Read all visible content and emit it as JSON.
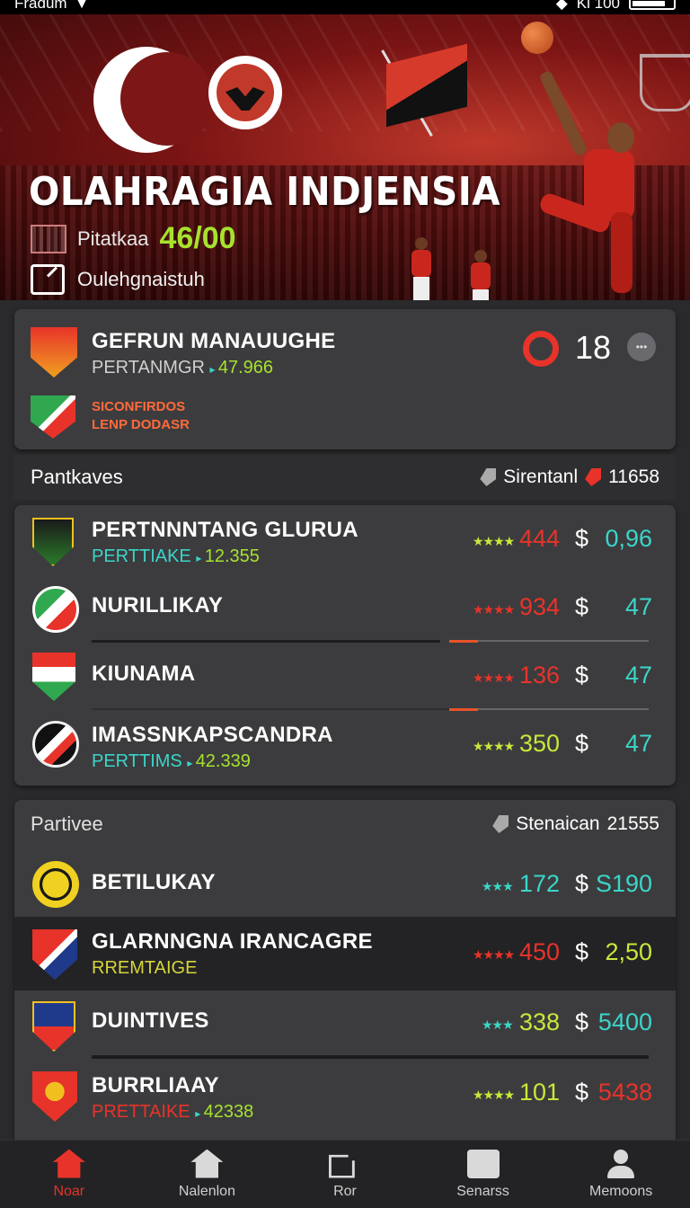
{
  "status_bar": {
    "carrier": "Fradum",
    "right_text": "Ki 100"
  },
  "hero": {
    "title": "OLAHRAGIA INDJENSIA",
    "stat_label": "Pitatkaa",
    "stat_value": "46/00",
    "action_label": "Oulehgnaistuh"
  },
  "featured_match": {
    "team": "GEFRUN MANAUUGHE",
    "sub_label": "PERTANMGR",
    "sub_value": "47.966",
    "line2": "SICONFIRDOS",
    "line3": "LENP DODASR",
    "score": "18"
  },
  "section1": {
    "name": "Pantkaves",
    "meta_label": "Sirentanl",
    "meta_value": "11658",
    "rows": [
      {
        "name": "PERTNNNTANG GLURUA",
        "sub_label": "PERTTIAKE",
        "sub_value": "12.355",
        "stars": "★★★★",
        "points": "444",
        "price": "0,96",
        "stars_color": "#c7e83a",
        "points_color": "#e8332a",
        "price_color": "#3ad6c9"
      },
      {
        "name": "NURILLIKAY",
        "sub_label": "",
        "sub_value": "",
        "stars": "★★★★",
        "points": "934",
        "price": "47",
        "stars_color": "#e8332a",
        "points_color": "#e8332a",
        "price_color": "#3ad6c9"
      },
      {
        "name": "KIUNAMA",
        "sub_label": "",
        "sub_value": "",
        "stars": "★★★★",
        "points": "136",
        "price": "47",
        "stars_color": "#e8332a",
        "points_color": "#e8332a",
        "price_color": "#3ad6c9"
      },
      {
        "name": "IMASSNKAPSCANDRA",
        "sub_label": "PERTTIMS",
        "sub_value": "42.339",
        "stars": "★★★★",
        "points": "350",
        "price": "47",
        "stars_color": "#c7e83a",
        "points_color": "#c7e83a",
        "price_color": "#3ad6c9"
      }
    ]
  },
  "section2": {
    "name": "Partivee",
    "meta_label": "Stenaican",
    "meta_value": "21555",
    "rows": [
      {
        "name": "BETILUKAY",
        "sub_label": "",
        "sub_value": "",
        "stars": "★★★",
        "points": "172",
        "price": "S190",
        "stars_color": "#3ad6c9",
        "points_color": "#3ad6c9",
        "price_color": "#3ad6c9"
      },
      {
        "name": "GLARNNGNA IRANCAGRE",
        "sub_label": "RREMTAIGE",
        "sub_value": "",
        "stars": "★★★★",
        "points": "450",
        "price": "2,50",
        "stars_color": "#e8332a",
        "points_color": "#e8332a",
        "price_color": "#c7e83a"
      },
      {
        "name": "DUINTIVES",
        "sub_label": "",
        "sub_value": "",
        "stars": "★★★",
        "points": "338",
        "price": "5400",
        "stars_color": "#3ad6c9",
        "points_color": "#c7e83a",
        "price_color": "#3ad6c9"
      },
      {
        "name": "BURRLIAAY",
        "sub_label": "PRETTAIKE",
        "sub_value": "42338",
        "stars": "★★★★",
        "points": "101",
        "price": "5438",
        "stars_color": "#c7e83a",
        "points_color": "#c7e83a",
        "price_color": "#e8332a"
      }
    ]
  },
  "currency_symbol": "$",
  "nav": [
    {
      "label": "Noar"
    },
    {
      "label": "Nalenlon"
    },
    {
      "label": "Ror"
    },
    {
      "label": "Senarss"
    },
    {
      "label": "Memoons"
    }
  ]
}
